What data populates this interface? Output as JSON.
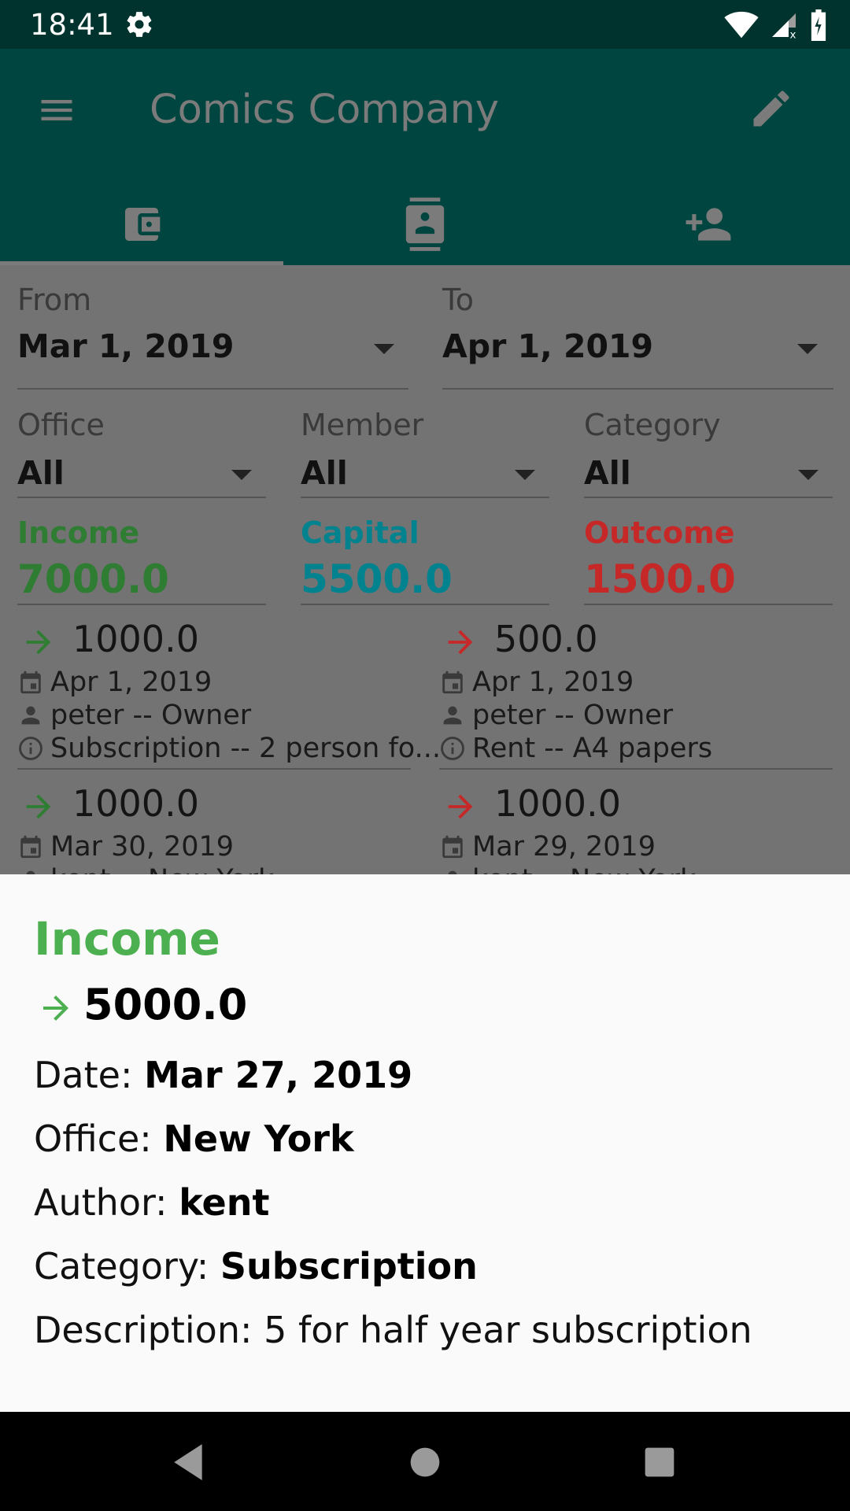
{
  "status_bar": {
    "time": "18:41",
    "icons": [
      "settings-icon",
      "wifi-icon",
      "signal-icon",
      "battery-charging-icon"
    ]
  },
  "app_bar": {
    "title": "Comics Company",
    "menu_icon": "menu-icon",
    "action_icon": "edit-icon"
  },
  "tabs": [
    {
      "icon": "wallet-icon",
      "active": true
    },
    {
      "icon": "contact-card-icon",
      "active": false
    },
    {
      "icon": "person-add-icon",
      "active": false
    }
  ],
  "filters": {
    "from": {
      "label": "From",
      "value": "Mar 1, 2019"
    },
    "to": {
      "label": "To",
      "value": "Apr 1, 2019"
    },
    "office": {
      "label": "Office",
      "value": "All"
    },
    "member": {
      "label": "Member",
      "value": "All"
    },
    "category": {
      "label": "Category",
      "value": "All"
    }
  },
  "summary": {
    "income": {
      "label": "Income",
      "value": "7000.0",
      "color": "#2e7d32"
    },
    "capital": {
      "label": "Capital",
      "value": "5500.0",
      "color": "#00838f"
    },
    "outcome": {
      "label": "Outcome",
      "value": "1500.0",
      "color": "#c62828"
    }
  },
  "income_entries": [
    {
      "amount": "1000.0",
      "date": "Apr 1, 2019",
      "person": "peter -- Owner",
      "info": "Subscription -- 2 person fo..."
    },
    {
      "amount": "1000.0",
      "date": "Mar 30, 2019",
      "person": "kent -- New York"
    }
  ],
  "outcome_entries": [
    {
      "amount": "500.0",
      "date": "Apr 1, 2019",
      "person": "peter -- Owner",
      "info": "Rent -- A4 papers"
    },
    {
      "amount": "1000.0",
      "date": "Mar 29, 2019",
      "person": "kent -- New York"
    }
  ],
  "detail_sheet": {
    "title": "Income",
    "amount": "5000.0",
    "date_label": "Date: ",
    "date": "Mar 27, 2019",
    "office_label": "Office: ",
    "office": "New York",
    "author_label": "Author: ",
    "author": "kent",
    "category_label": "Category: ",
    "category": "Subscription",
    "description_label": "Description: ",
    "description": "5 for half year subscription",
    "accent_color": "#4caf50"
  },
  "nav_bar": {
    "buttons": [
      "back-icon",
      "home-icon",
      "recents-icon"
    ]
  }
}
